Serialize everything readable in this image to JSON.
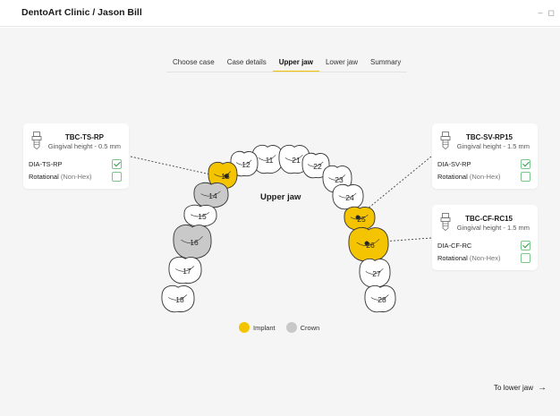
{
  "app": {
    "title": "DentoArt Clinic / Jason Bill"
  },
  "window": {
    "minimize_icon": "minimize-icon",
    "restore_icon": "restore-icon",
    "minimize_glyph": "–",
    "restore_glyph": "◻"
  },
  "steps": [
    {
      "label": "Choose case",
      "active": false
    },
    {
      "label": "Case details",
      "active": false
    },
    {
      "label": "Upper jaw",
      "active": true
    },
    {
      "label": "Lower jaw",
      "active": false
    },
    {
      "label": "Summary",
      "active": false
    }
  ],
  "jaw_label": "Upper jaw",
  "teeth": [
    {
      "number": "11",
      "state": "none"
    },
    {
      "number": "12",
      "state": "none"
    },
    {
      "number": "13",
      "state": "implant"
    },
    {
      "number": "14",
      "state": "crown"
    },
    {
      "number": "15",
      "state": "none"
    },
    {
      "number": "16",
      "state": "crown"
    },
    {
      "number": "17",
      "state": "none"
    },
    {
      "number": "18",
      "state": "none"
    },
    {
      "number": "21",
      "state": "none"
    },
    {
      "number": "22",
      "state": "none"
    },
    {
      "number": "23",
      "state": "none"
    },
    {
      "number": "24",
      "state": "none"
    },
    {
      "number": "25",
      "state": "implant"
    },
    {
      "number": "26",
      "state": "implant"
    },
    {
      "number": "27",
      "state": "none"
    },
    {
      "number": "28",
      "state": "none"
    }
  ],
  "cards": [
    {
      "tooth": "13",
      "code": "TBC-TS-RP",
      "gingival_height": "Gingival height - 0.5 mm",
      "options": [
        {
          "name": "DIA-TS-RP",
          "suffix": "",
          "checked": true
        },
        {
          "name": "Rotational",
          "suffix": "(Non-Hex)",
          "checked": false
        }
      ]
    },
    {
      "tooth": "25",
      "code": "TBC-SV-RP15",
      "gingival_height": "Gingival height - 1.5 mm",
      "options": [
        {
          "name": "DIA-SV-RP",
          "suffix": "",
          "checked": true
        },
        {
          "name": "Rotational",
          "suffix": "(Non-Hex)",
          "checked": false
        }
      ]
    },
    {
      "tooth": "26",
      "code": "TBC-CF-RC15",
      "gingival_height": "Gingival height - 1.5 mm",
      "options": [
        {
          "name": "DIA-CF-RC",
          "suffix": "",
          "checked": true
        },
        {
          "name": "Rotational",
          "suffix": "(Non-Hex)",
          "checked": false
        }
      ]
    }
  ],
  "legend": [
    {
      "label": "Implant",
      "color": "#f5c400"
    },
    {
      "label": "Crown",
      "color": "#c8c8c8"
    }
  ],
  "colors": {
    "implant": "#f5c400",
    "crown": "#c9c9c9",
    "none": "#ffffff",
    "accent": "#f2c200"
  },
  "next_button": {
    "label": "To lower jaw",
    "icon": "arrow-right-icon"
  }
}
